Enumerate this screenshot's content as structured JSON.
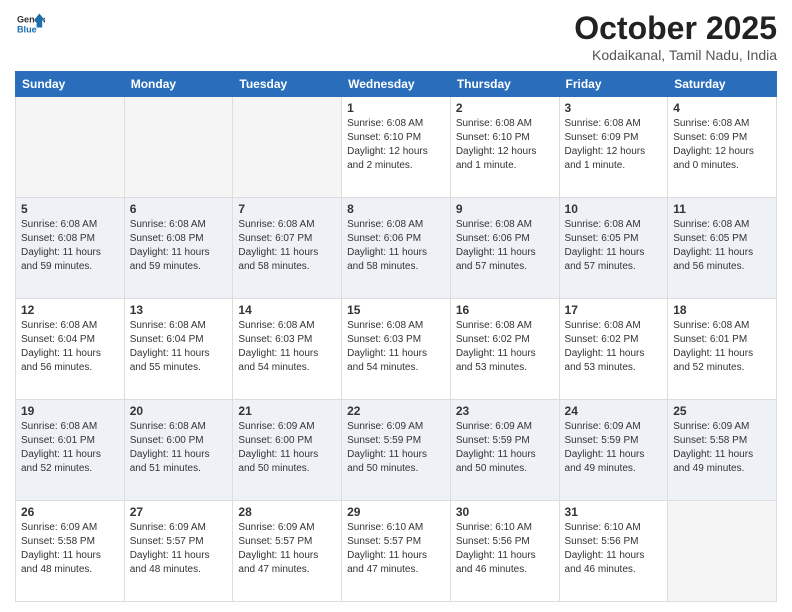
{
  "header": {
    "logo_general": "General",
    "logo_blue": "Blue",
    "title": "October 2025",
    "location": "Kodaikanal, Tamil Nadu, India"
  },
  "days_of_week": [
    "Sunday",
    "Monday",
    "Tuesday",
    "Wednesday",
    "Thursday",
    "Friday",
    "Saturday"
  ],
  "weeks": [
    [
      {
        "day": "",
        "info": ""
      },
      {
        "day": "",
        "info": ""
      },
      {
        "day": "",
        "info": ""
      },
      {
        "day": "1",
        "info": "Sunrise: 6:08 AM\nSunset: 6:10 PM\nDaylight: 12 hours\nand 2 minutes."
      },
      {
        "day": "2",
        "info": "Sunrise: 6:08 AM\nSunset: 6:10 PM\nDaylight: 12 hours\nand 1 minute."
      },
      {
        "day": "3",
        "info": "Sunrise: 6:08 AM\nSunset: 6:09 PM\nDaylight: 12 hours\nand 1 minute."
      },
      {
        "day": "4",
        "info": "Sunrise: 6:08 AM\nSunset: 6:09 PM\nDaylight: 12 hours\nand 0 minutes."
      }
    ],
    [
      {
        "day": "5",
        "info": "Sunrise: 6:08 AM\nSunset: 6:08 PM\nDaylight: 11 hours\nand 59 minutes."
      },
      {
        "day": "6",
        "info": "Sunrise: 6:08 AM\nSunset: 6:08 PM\nDaylight: 11 hours\nand 59 minutes."
      },
      {
        "day": "7",
        "info": "Sunrise: 6:08 AM\nSunset: 6:07 PM\nDaylight: 11 hours\nand 58 minutes."
      },
      {
        "day": "8",
        "info": "Sunrise: 6:08 AM\nSunset: 6:06 PM\nDaylight: 11 hours\nand 58 minutes."
      },
      {
        "day": "9",
        "info": "Sunrise: 6:08 AM\nSunset: 6:06 PM\nDaylight: 11 hours\nand 57 minutes."
      },
      {
        "day": "10",
        "info": "Sunrise: 6:08 AM\nSunset: 6:05 PM\nDaylight: 11 hours\nand 57 minutes."
      },
      {
        "day": "11",
        "info": "Sunrise: 6:08 AM\nSunset: 6:05 PM\nDaylight: 11 hours\nand 56 minutes."
      }
    ],
    [
      {
        "day": "12",
        "info": "Sunrise: 6:08 AM\nSunset: 6:04 PM\nDaylight: 11 hours\nand 56 minutes."
      },
      {
        "day": "13",
        "info": "Sunrise: 6:08 AM\nSunset: 6:04 PM\nDaylight: 11 hours\nand 55 minutes."
      },
      {
        "day": "14",
        "info": "Sunrise: 6:08 AM\nSunset: 6:03 PM\nDaylight: 11 hours\nand 54 minutes."
      },
      {
        "day": "15",
        "info": "Sunrise: 6:08 AM\nSunset: 6:03 PM\nDaylight: 11 hours\nand 54 minutes."
      },
      {
        "day": "16",
        "info": "Sunrise: 6:08 AM\nSunset: 6:02 PM\nDaylight: 11 hours\nand 53 minutes."
      },
      {
        "day": "17",
        "info": "Sunrise: 6:08 AM\nSunset: 6:02 PM\nDaylight: 11 hours\nand 53 minutes."
      },
      {
        "day": "18",
        "info": "Sunrise: 6:08 AM\nSunset: 6:01 PM\nDaylight: 11 hours\nand 52 minutes."
      }
    ],
    [
      {
        "day": "19",
        "info": "Sunrise: 6:08 AM\nSunset: 6:01 PM\nDaylight: 11 hours\nand 52 minutes."
      },
      {
        "day": "20",
        "info": "Sunrise: 6:08 AM\nSunset: 6:00 PM\nDaylight: 11 hours\nand 51 minutes."
      },
      {
        "day": "21",
        "info": "Sunrise: 6:09 AM\nSunset: 6:00 PM\nDaylight: 11 hours\nand 50 minutes."
      },
      {
        "day": "22",
        "info": "Sunrise: 6:09 AM\nSunset: 5:59 PM\nDaylight: 11 hours\nand 50 minutes."
      },
      {
        "day": "23",
        "info": "Sunrise: 6:09 AM\nSunset: 5:59 PM\nDaylight: 11 hours\nand 50 minutes."
      },
      {
        "day": "24",
        "info": "Sunrise: 6:09 AM\nSunset: 5:59 PM\nDaylight: 11 hours\nand 49 minutes."
      },
      {
        "day": "25",
        "info": "Sunrise: 6:09 AM\nSunset: 5:58 PM\nDaylight: 11 hours\nand 49 minutes."
      }
    ],
    [
      {
        "day": "26",
        "info": "Sunrise: 6:09 AM\nSunset: 5:58 PM\nDaylight: 11 hours\nand 48 minutes."
      },
      {
        "day": "27",
        "info": "Sunrise: 6:09 AM\nSunset: 5:57 PM\nDaylight: 11 hours\nand 48 minutes."
      },
      {
        "day": "28",
        "info": "Sunrise: 6:09 AM\nSunset: 5:57 PM\nDaylight: 11 hours\nand 47 minutes."
      },
      {
        "day": "29",
        "info": "Sunrise: 6:10 AM\nSunset: 5:57 PM\nDaylight: 11 hours\nand 47 minutes."
      },
      {
        "day": "30",
        "info": "Sunrise: 6:10 AM\nSunset: 5:56 PM\nDaylight: 11 hours\nand 46 minutes."
      },
      {
        "day": "31",
        "info": "Sunrise: 6:10 AM\nSunset: 5:56 PM\nDaylight: 11 hours\nand 46 minutes."
      },
      {
        "day": "",
        "info": ""
      }
    ]
  ]
}
